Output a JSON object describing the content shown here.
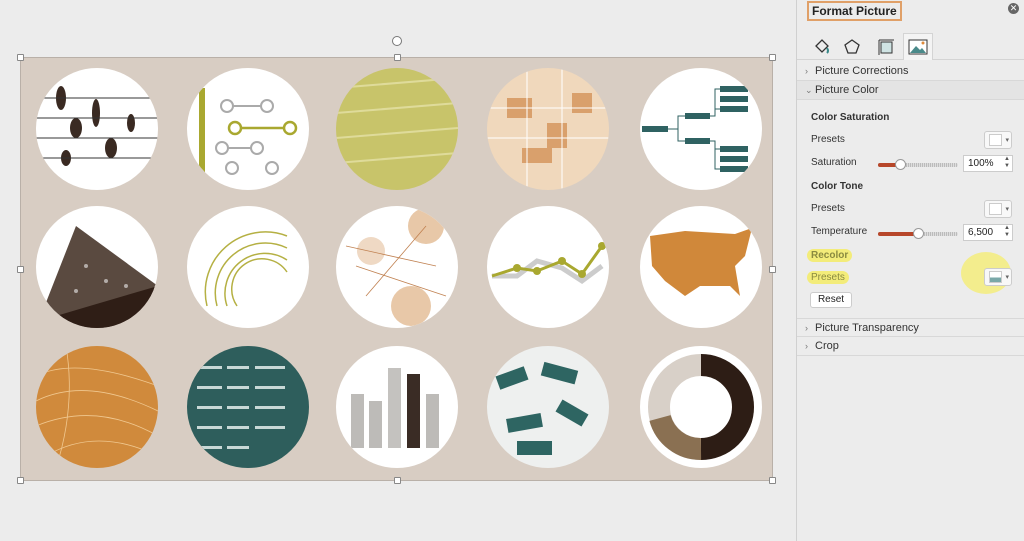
{
  "panel": {
    "title": "Format Picture",
    "tabs": [
      {
        "icon": "fill-line-icon"
      },
      {
        "icon": "effects-pentagon-icon"
      },
      {
        "icon": "size-properties-icon"
      },
      {
        "icon": "picture-icon",
        "active": true
      }
    ],
    "sections": {
      "corrections": "Picture Corrections",
      "color": "Picture Color",
      "transparency": "Picture Transparency",
      "crop": "Crop"
    },
    "saturation": {
      "heading": "Color Saturation",
      "presets": "Presets",
      "label": "Saturation",
      "value": "100%",
      "slider_fraction": 0.28
    },
    "tone": {
      "heading": "Color Tone",
      "presets": "Presets",
      "label": "Temperature",
      "value": "6,500",
      "slider_fraction": 0.5
    },
    "recolor": {
      "heading": "Recolor",
      "presets": "Presets"
    },
    "reset": "Reset",
    "highlight_color": "#f3ec7a",
    "accent": "#b7472a"
  },
  "canvas": {
    "background": "#d8cdc3"
  }
}
